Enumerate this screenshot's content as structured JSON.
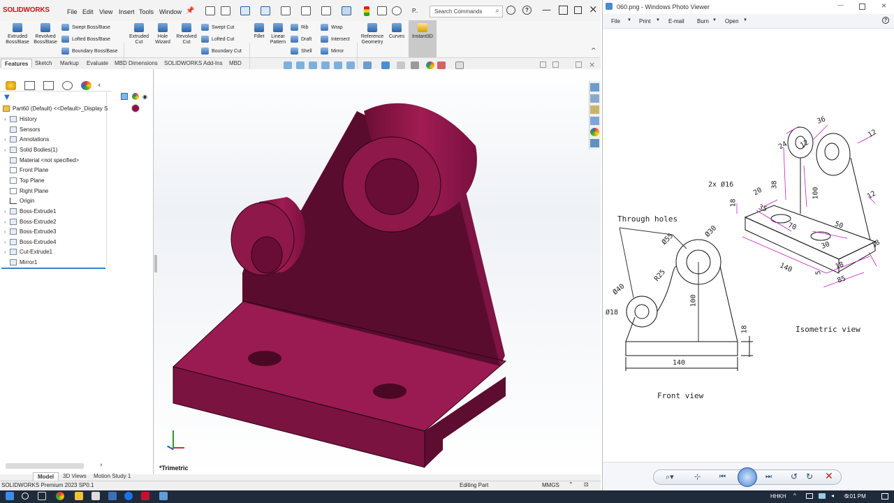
{
  "solidworks": {
    "logo": "SOLIDWORKS",
    "menus": [
      "File",
      "Edit",
      "View",
      "Insert",
      "Tools",
      "Window"
    ],
    "search_placeholder": "Search Commands",
    "ribbon": {
      "extruded_boss": "Extruded Boss/Base",
      "revolved_boss": "Revolved Boss/Base",
      "swept_boss": "Swept Boss/Base",
      "lofted_boss": "Lofted Boss/Base",
      "boundary_boss": "Boundary Boss/Base",
      "extruded_cut": "Extruded Cut",
      "hole_wizard": "Hole Wizard",
      "revolved_cut": "Revolved Cut",
      "swept_cut": "Swept Cut",
      "lofted_cut": "Lofted Cut",
      "boundary_cut": "Boundary Cut",
      "fillet": "Fillet",
      "linear_pattern": "Linear Pattern",
      "rib": "Rib",
      "draft": "Draft",
      "shell": "Shell",
      "wrap": "Wrap",
      "intersect": "Intersect",
      "mirror": "Mirror",
      "reference_geometry": "Reference Geometry",
      "curves": "Curves",
      "instant3d": "Instant3D"
    },
    "tabs": [
      "Features",
      "Sketch",
      "Markup",
      "Evaluate",
      "MBD Dimensions",
      "SOLIDWORKS Add-Ins",
      "MBD"
    ],
    "tree": {
      "root": "Part60 (Default) <<Default>_Display S",
      "items": [
        "History",
        "Sensors",
        "Annotations",
        "Solid Bodies(1)",
        "Material <not specified>",
        "Front Plane",
        "Top Plane",
        "Right Plane",
        "Origin",
        "Boss-Extrude1",
        "Boss-Extrude2",
        "Boss-Extrude3",
        "Boss-Extrude4",
        "Cut-Extrude1",
        "Mirror1"
      ]
    },
    "view_label": "*Trimetric",
    "bottom_tabs": [
      "Model",
      "3D Views",
      "Motion Study 1"
    ],
    "status": {
      "product": "SOLIDWORKS Premium 2023 SP0.1",
      "mode": "Editing Part",
      "units": "MMGS"
    },
    "model_color": "#8a1446"
  },
  "photo_viewer": {
    "title": "060.png - Windows Photo Viewer",
    "menu": [
      "File",
      "Print",
      "E-mail",
      "Burn",
      "Open"
    ],
    "drawing": {
      "through_holes": "Through holes",
      "front_view": "Front view",
      "isometric_view": "Isometric view",
      "front_dims": [
        "Ø55",
        "Ø30",
        "R25",
        "Ø40",
        "Ø18",
        "100",
        "18",
        "140"
      ],
      "iso_dims": [
        "2x Ø16",
        "36",
        "24",
        "12",
        "12",
        "38",
        "20",
        "100",
        "18",
        "35",
        "70",
        "50",
        "30",
        "12",
        "140",
        "18",
        "5",
        "18",
        "85"
      ]
    }
  },
  "taskbar": {
    "lang": "HHKH",
    "time": "5:01 PM"
  }
}
